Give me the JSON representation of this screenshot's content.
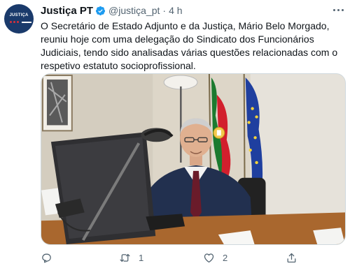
{
  "account": {
    "avatar_text": "JUSTIÇA",
    "display_name": "Justiça PT",
    "handle": "@justiça_pt",
    "separator": "·",
    "time": "4 h"
  },
  "tweet": {
    "text": "O Secretário de Estado Adjunto e da Justiça, Mário Belo Morgado, reuniu hoje com uma delegação do Sindicato dos Funcionários Judiciais, tendo sido analisadas várias questões relacionadas com o respetivo estatuto socioprofissional."
  },
  "actions": {
    "reply_icon": "reply-icon",
    "retweet_icon": "retweet-icon",
    "retweet_count": "1",
    "like_icon": "heart-icon",
    "like_count": "2",
    "share_icon": "share-icon"
  },
  "colors": {
    "text": "#0f1419",
    "muted": "#536471",
    "verified": "#1d9bf0",
    "avatar_bg": "#1a3a6b"
  }
}
